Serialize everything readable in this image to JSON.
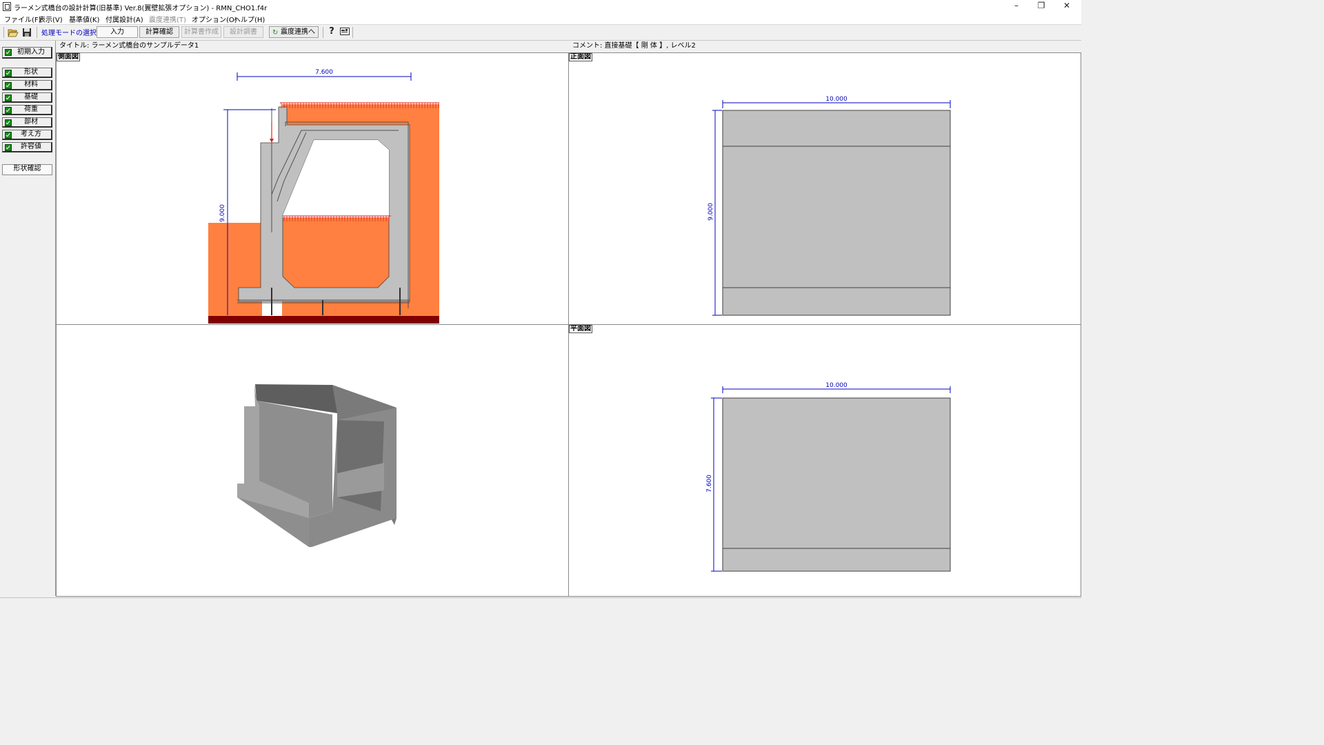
{
  "window": {
    "title": "ラーメン式橋台の設計計算(旧基準) Ver.8(翼壁拡張オプション) - RMN_CHO1.f4r",
    "minimize": "–",
    "restore": "❐",
    "close": "✕"
  },
  "menu": [
    {
      "label": "ファイル(F)",
      "enabled": true
    },
    {
      "label": "表示(V)",
      "enabled": true
    },
    {
      "label": "基準値(K)",
      "enabled": true
    },
    {
      "label": "付属設計(A)",
      "enabled": true
    },
    {
      "label": "震度連携(T)",
      "enabled": false
    },
    {
      "label": "オプション(O)",
      "enabled": true
    },
    {
      "label": "ヘルプ(H)",
      "enabled": true
    }
  ],
  "toolbar": {
    "open_icon": "folder-open-icon",
    "save_icon": "floppy-save-icon",
    "mode_label": "処理モードの選択",
    "input": "入力",
    "calc_check": "計算確認",
    "report_create": "計算書作成",
    "design_sheet": "設計調書",
    "seismic_link": "震度連携へ",
    "help_icon": "help-question-icon",
    "about_icon": "about-icon"
  },
  "sidebar": {
    "initial_input": "初期入力",
    "items": [
      {
        "label": "形状",
        "checked": true
      },
      {
        "label": "材料",
        "checked": true
      },
      {
        "label": "基礎",
        "checked": true
      },
      {
        "label": "荷重",
        "checked": true
      },
      {
        "label": "部材",
        "checked": true
      },
      {
        "label": "考え方",
        "checked": true
      },
      {
        "label": "許容値",
        "checked": true
      }
    ],
    "shape_check": "形状確認"
  },
  "info": {
    "title": "タイトル: ラーメン式橋台のサンプルデータ1",
    "comment": "コメント: 直接基礎【 剛  体 】, レベル2"
  },
  "views": {
    "side": {
      "label": "側面図",
      "dim_width": "7.600",
      "dim_height": "9.000",
      "colors": {
        "soil": "#ff8040",
        "concrete": "#c0c0c0",
        "base": "#800000",
        "dim": "#0000c0",
        "load": "#e02020"
      }
    },
    "front": {
      "label": "正面図",
      "dim_width": "10.000",
      "dim_height": "9.000"
    },
    "plan": {
      "label": "平面図",
      "dim_width": "10.000",
      "dim_height": "7.600"
    },
    "perspective": {
      "label": "",
      "color": "#8c8c8c"
    }
  }
}
